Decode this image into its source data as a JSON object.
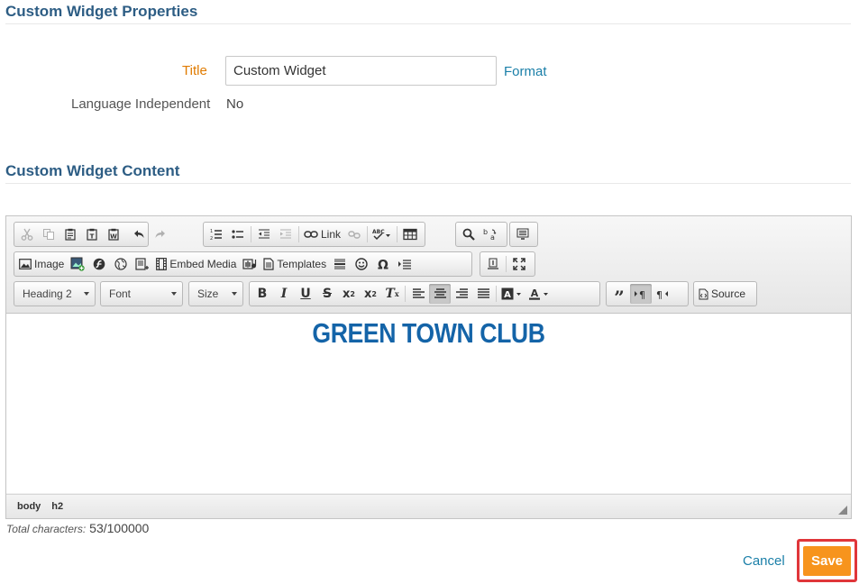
{
  "properties": {
    "title": "Custom Widget Properties",
    "title_label": "Title",
    "title_value": "Custom Widget",
    "format_link": "Format",
    "lang_label": "Language Independent",
    "lang_value": "No"
  },
  "content": {
    "title": "Custom Widget Content"
  },
  "toolbar": {
    "link_label": "Link",
    "image_label": "Image",
    "embed_media_label": "Embed Media",
    "templates_label": "Templates",
    "format_combo": "Heading 2",
    "font_combo": "Font",
    "size_combo": "Size",
    "source_label": "Source"
  },
  "editor": {
    "heading_text": "GREEN TOWN CLUB",
    "heading_color": "#1464a8",
    "path": [
      "body",
      "h2"
    ]
  },
  "footer": {
    "char_label": "Total characters:",
    "char_value": "53/100000",
    "cancel_label": "Cancel",
    "save_label": "Save",
    "save_color": "#f7941d"
  }
}
